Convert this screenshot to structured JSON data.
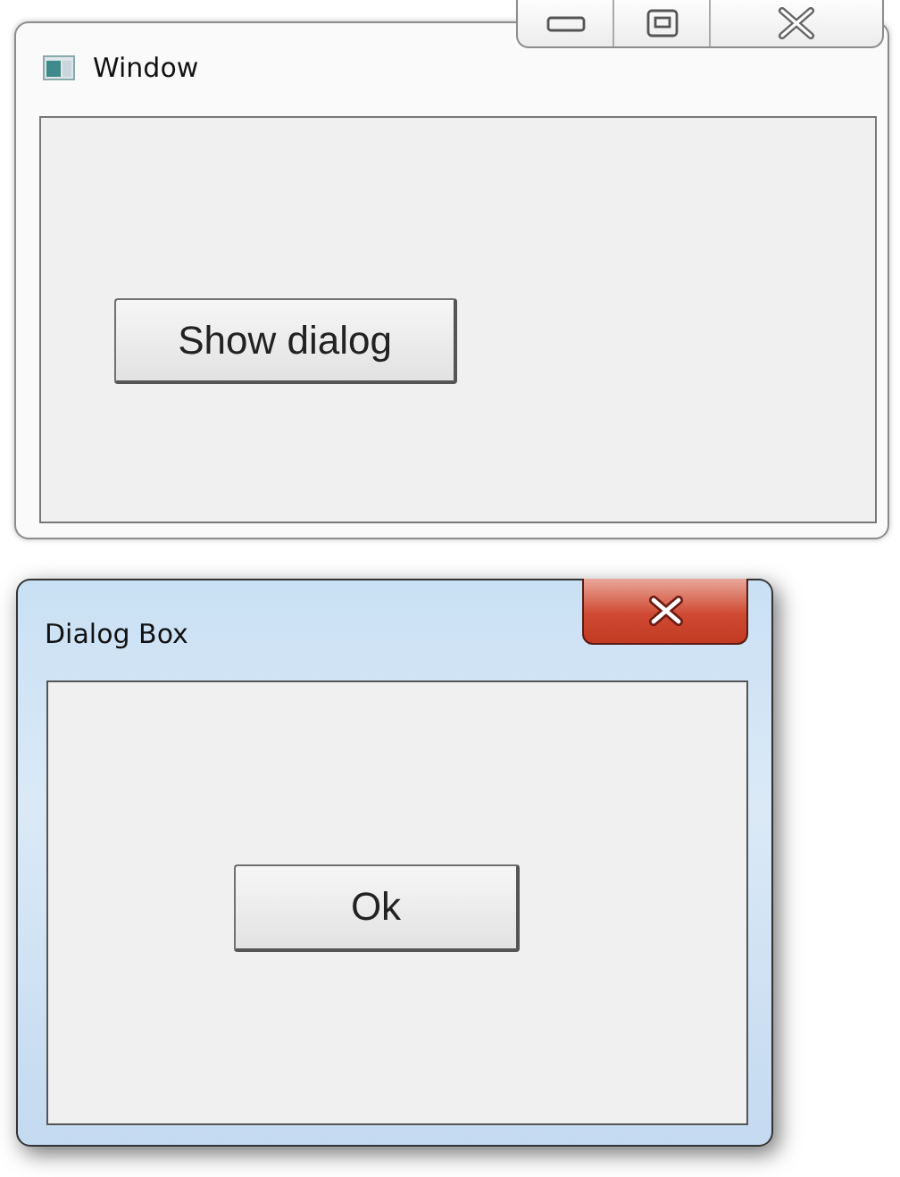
{
  "main_window": {
    "title": "Window",
    "button": "Show dialog"
  },
  "dialog": {
    "title": "Dialog Box",
    "button": "Ok"
  }
}
